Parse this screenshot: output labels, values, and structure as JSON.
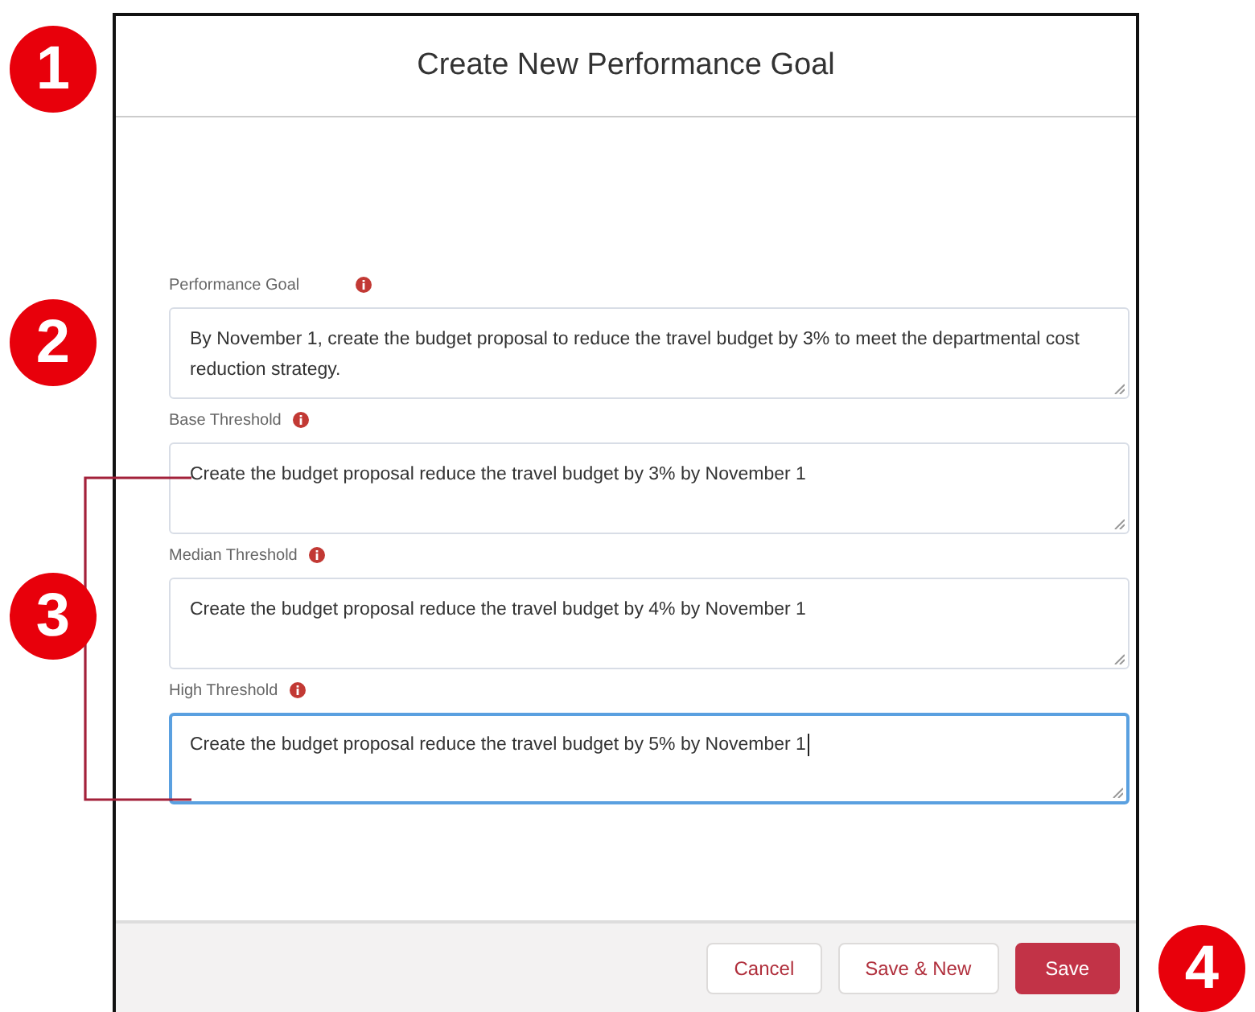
{
  "dialog": {
    "title": "Create New Performance Goal"
  },
  "fields": [
    {
      "label": "Performance Goal",
      "value": "By November 1, create the budget proposal to reduce the travel budget by 3% to meet the departmental cost reduction strategy.",
      "focused": false
    },
    {
      "label": "Base Threshold",
      "value": "Create the budget proposal reduce the travel budget by 3% by November 1",
      "focused": false
    },
    {
      "label": "Median Threshold",
      "value": "Create the budget proposal reduce the travel budget by 4% by November 1",
      "focused": false
    },
    {
      "label": "High Threshold",
      "value": "Create the budget proposal reduce the travel budget by 5% by November 1",
      "focused": true
    }
  ],
  "buttons": [
    {
      "label": "Cancel",
      "kind": "neutral"
    },
    {
      "label": "Save & New",
      "kind": "neutral"
    },
    {
      "label": "Save",
      "kind": "brand"
    }
  ],
  "callouts": [
    "1",
    "2",
    "3",
    "4"
  ]
}
